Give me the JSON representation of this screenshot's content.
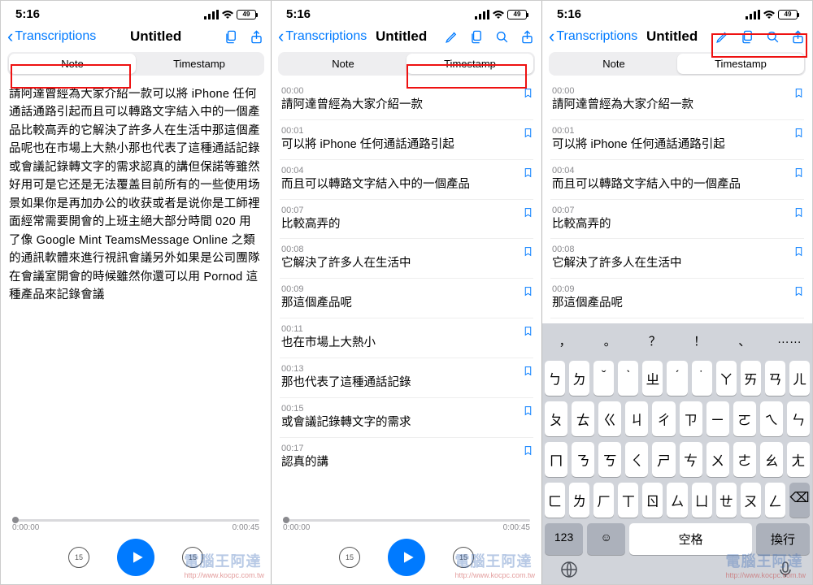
{
  "status": {
    "time": "5:16",
    "battery": "49"
  },
  "nav": {
    "back": "Transcriptions",
    "title": "Untitled"
  },
  "tabs": {
    "note": "Note",
    "timestamp": "Timestamp"
  },
  "note_body": "請阿達曾經為大家介紹一款可以將 iPhone 任何通話通路引起而且可以轉路文字結入中的一個產品比較高弄的它解決了許多人在生活中那這個產品呢也在市場上大熱小那也代表了這種通話記錄或會議記錄轉文字的需求認真的講但保諾等雖然好用可是它还是无法覆盖目前所有的一些使用场景如果你是再加办公的收获或者是说你是工師裡面經常需要開會的上班主絕大部分時間 020 用了像 Google Mint TeamsMessage Online 之類的通訊軟體來進行視訊會議另外如果是公司團隊在會議室開會的時候雖然你還可以用 Pornod 這種產品來記錄會議",
  "segments": [
    {
      "t": "00:00",
      "txt": "請阿達曾經為大家介紹一款"
    },
    {
      "t": "00:01",
      "txt": "可以將 iPhone 任何通話通路引起"
    },
    {
      "t": "00:04",
      "txt": "而且可以轉路文字結入中的一個產品"
    },
    {
      "t": "00:07",
      "txt": "比較高弄的"
    },
    {
      "t": "00:08",
      "txt": "它解決了許多人在生活中"
    },
    {
      "t": "00:09",
      "txt": "那這個產品呢"
    },
    {
      "t": "00:11",
      "txt": "也在市場上大熱小"
    },
    {
      "t": "00:13",
      "txt": "那也代表了這種通話記錄"
    },
    {
      "t": "00:15",
      "txt": "或會議記錄轉文字的需求"
    },
    {
      "t": "00:17",
      "txt": "認真的講"
    }
  ],
  "segments_short": [
    {
      "t": "00:00",
      "txt": "請阿達曾經為大家介紹一款"
    },
    {
      "t": "00:01",
      "txt": "可以將 iPhone 任何通話通路引起"
    },
    {
      "t": "00:04",
      "txt": "而且可以轉路文字結入中的一個產品"
    },
    {
      "t": "00:07",
      "txt": "比較高弄的"
    },
    {
      "t": "00:08",
      "txt": "它解決了許多人在生活中"
    },
    {
      "t": "00:09",
      "txt": "那這個產品呢"
    },
    {
      "t": "00:11",
      "txt": "也在市場上大熱小"
    }
  ],
  "player": {
    "cur": "0:00:00",
    "dur": "0:00:45",
    "skip": "15"
  },
  "kbd": {
    "punct": [
      "，",
      "。",
      "？",
      "！",
      "、",
      "……"
    ],
    "r1": [
      "ㄅ",
      "ㄉ",
      "ˇ",
      "ˋ",
      "ㄓ",
      "ˊ",
      "˙",
      "ㄚ",
      "ㄞ",
      "ㄢ",
      "ㄦ"
    ],
    "r2": [
      "ㄆ",
      "ㄊ",
      "ㄍ",
      "ㄐ",
      "ㄔ",
      "ㄗ",
      "ㄧ",
      "ㄛ",
      "ㄟ",
      "ㄣ"
    ],
    "r3": [
      "ㄇ",
      "ㄋ",
      "ㄎ",
      "ㄑ",
      "ㄕ",
      "ㄘ",
      "ㄨ",
      "ㄜ",
      "ㄠ",
      "ㄤ"
    ],
    "r4": [
      "ㄈ",
      "ㄌ",
      "ㄏ",
      "ㄒ",
      "ㄖ",
      "ㄙ",
      "ㄩ",
      "ㄝ",
      "ㄡ",
      "ㄥ"
    ],
    "num": "123",
    "space": "空格",
    "ret": "換行"
  },
  "watermark": {
    "main": "電腦王阿達",
    "sub": "http://www.kocpc.com.tw"
  }
}
